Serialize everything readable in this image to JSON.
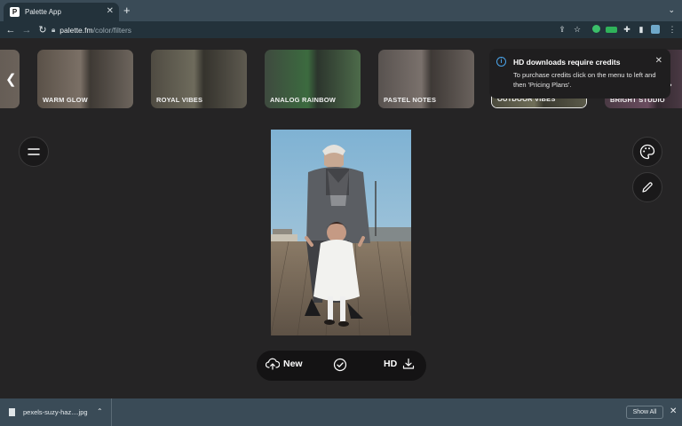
{
  "browser": {
    "tab_title": "Palette App",
    "tab_favicon_letter": "P",
    "url_host": "palette.fm",
    "url_path": "/color/filters"
  },
  "filters": {
    "items": [
      {
        "label": "WARM GLOW",
        "colors": [
          "#5a5148",
          "#7b7066",
          "#6d655d"
        ]
      },
      {
        "label": "ROYAL VIBES",
        "colors": [
          "#4f4b42",
          "#6e6b5c",
          "#5e5a50"
        ]
      },
      {
        "label": "ANALOG RAINBOW",
        "colors": [
          "#3e4a3f",
          "#3c6b3f",
          "#4d5b4a"
        ]
      },
      {
        "label": "PASTEL NOTES",
        "colors": [
          "#58524f",
          "#7a716c",
          "#6a625d"
        ]
      },
      {
        "label": "OUTDOOR VIBES",
        "colors": [
          "#4b4a3d",
          "#6f6e58",
          "#5b5a4a"
        ],
        "selected": true
      },
      {
        "label": "BRIGHT STUDIO",
        "colors": [
          "#4a3a44",
          "#6a4c5f",
          "#5a4552"
        ]
      }
    ]
  },
  "toast": {
    "title": "HD downloads require credits",
    "body": "To purchase credits click on the menu to left and then 'Pricing Plans'."
  },
  "actions": {
    "new_label": "New",
    "hd_label": "HD"
  },
  "download_shelf": {
    "filename": "pexels-suzy-haz....jpg",
    "show_all_label": "Show All"
  },
  "colors": {
    "accent_info": "#4aa3e8",
    "app_background": "#252425",
    "browser_chrome": "#3a4b57"
  }
}
